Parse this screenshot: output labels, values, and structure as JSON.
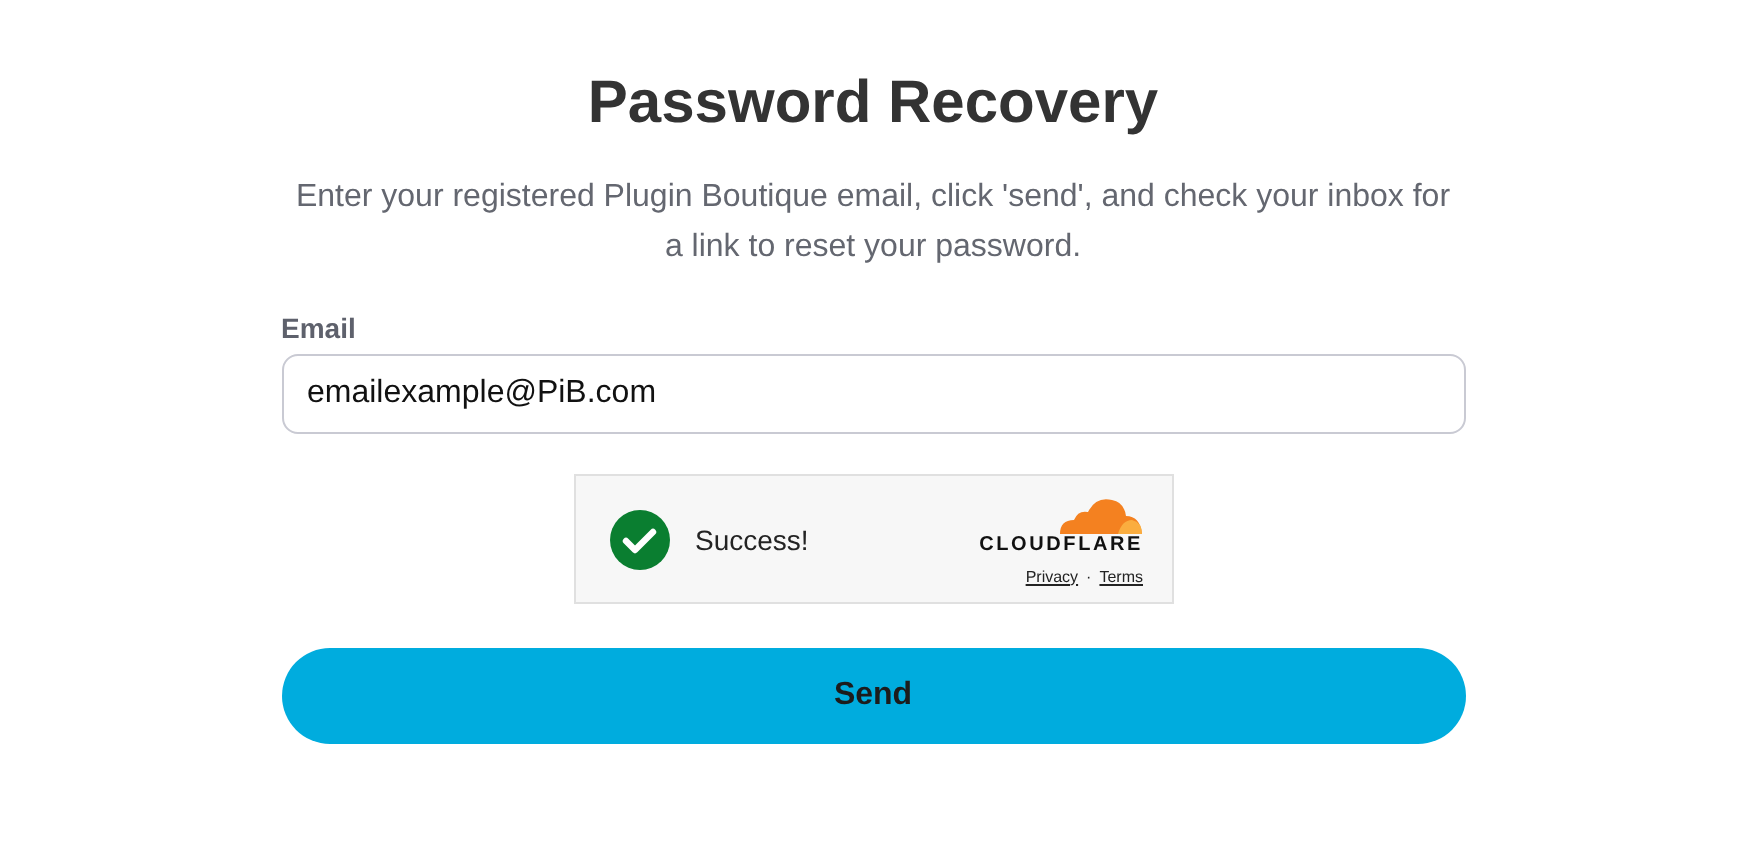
{
  "title": "Password Recovery",
  "description": "Enter your registered Plugin Boutique email, click 'send', and check your inbox for a link to reset your password.",
  "email_field": {
    "label": "Email",
    "value": "emailexample@PiB.com"
  },
  "captcha": {
    "verified": true,
    "message": "Success!",
    "brand": "CLOUDFLARE",
    "links": [
      "Privacy",
      "Terms"
    ],
    "separator": "·"
  },
  "buttons": [
    "Send"
  ]
}
